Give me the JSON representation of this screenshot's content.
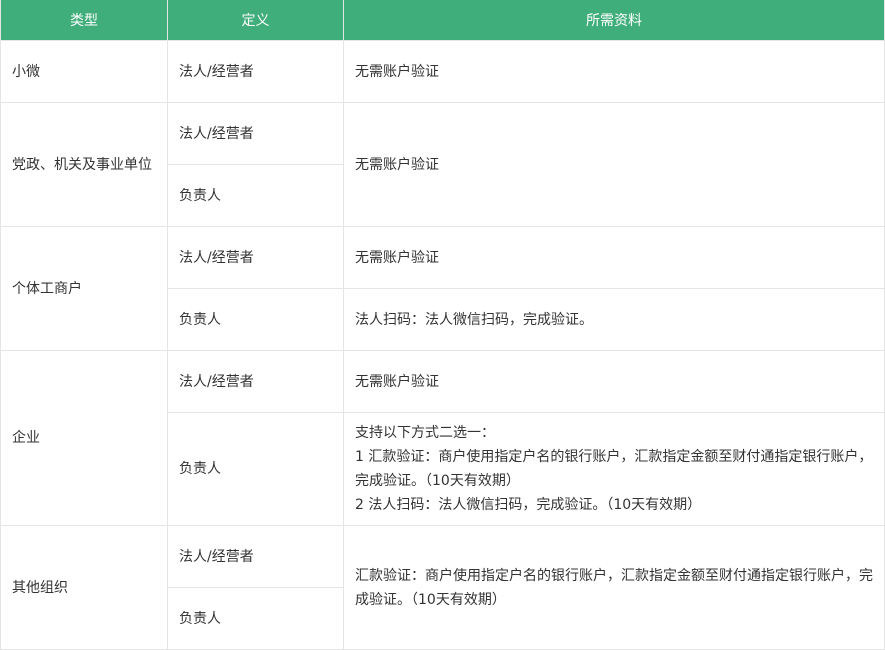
{
  "headers": {
    "type": "类型",
    "definition": "定义",
    "materials": "所需资料"
  },
  "rows": {
    "xiaowei": {
      "type": "小微",
      "legal": "法人/经营者",
      "legal_req": "无需账户验证"
    },
    "party": {
      "type": "党政、机关及事业单位",
      "legal": "法人/经营者",
      "responsible": "负责人",
      "req": "无需账户验证"
    },
    "individual": {
      "type": "个体工商户",
      "legal": "法人/经营者",
      "legal_req": "无需账户验证",
      "responsible": "负责人",
      "responsible_req": "法人扫码：法人微信扫码，完成验证。"
    },
    "enterprise": {
      "type": "企业",
      "legal": "法人/经营者",
      "legal_req": "无需账户验证",
      "responsible": "负责人",
      "responsible_req": {
        "intro": "支持以下方式二选一：",
        "option1": "1 汇款验证：商户使用指定户名的银行账户，汇款指定金额至财付通指定银行账户，完成验证。（10天有效期）",
        "option2": "2 法人扫码：法人微信扫码，完成验证。（10天有效期）"
      }
    },
    "other": {
      "type": "其他组织",
      "legal": "法人/经营者",
      "responsible": "负责人",
      "req": "汇款验证：商户使用指定户名的银行账户，汇款指定金额至财付通指定银行账户，完成验证。（10天有效期）"
    }
  }
}
